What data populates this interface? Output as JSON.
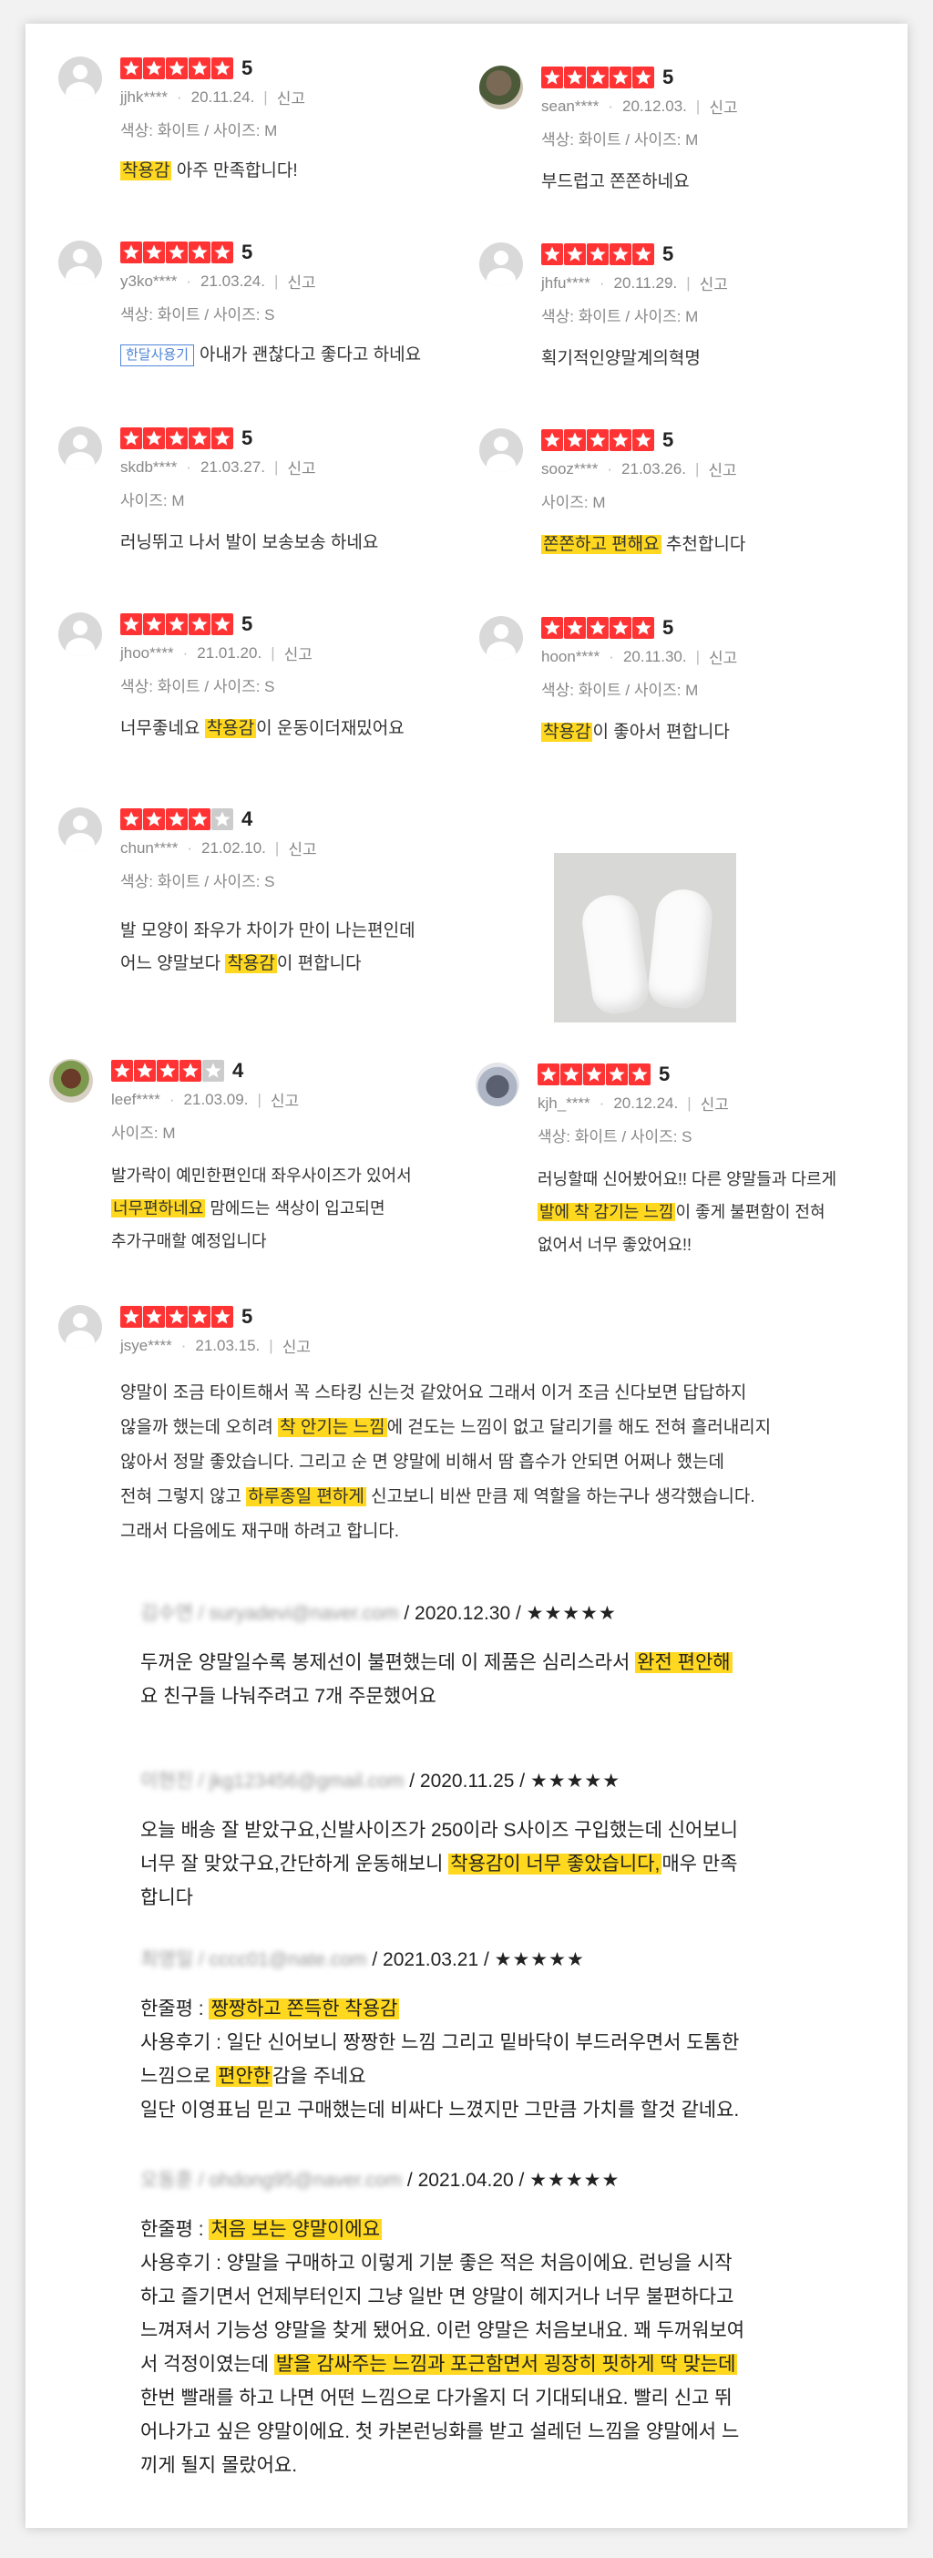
{
  "reviews": [
    {
      "user": "jjhk****",
      "date": "20.11.24.",
      "report": "신고",
      "option": "색상: 화이트 / 사이즈: M",
      "score": "5",
      "rating": 5,
      "text_pre": "",
      "highlight": "착용감",
      "text_post": " 아주 만족합니다!"
    },
    {
      "user": "sean****",
      "date": "20.12.03.",
      "report": "신고",
      "option": "색상: 화이트 / 사이즈: M",
      "score": "5",
      "rating": 5,
      "text_pre": "부드럽고 쫀쫀하네요",
      "highlight": "",
      "text_post": ""
    },
    {
      "user": "y3ko****",
      "date": "21.03.24.",
      "report": "신고",
      "option": "색상: 화이트 / 사이즈: S",
      "score": "5",
      "rating": 5,
      "tag": "한달사용기",
      "text_pre": "아내가 괜찮다고 좋다고 하네요",
      "highlight": "",
      "text_post": ""
    },
    {
      "user": "jhfu****",
      "date": "20.11.29.",
      "report": "신고",
      "option": "색상: 화이트 / 사이즈: M",
      "score": "5",
      "rating": 5,
      "text_pre": "획기적인양말계의혁명",
      "highlight": "",
      "text_post": ""
    },
    {
      "user": "skdb****",
      "date": "21.03.27.",
      "report": "신고",
      "option": "사이즈: M",
      "score": "5",
      "rating": 5,
      "text_pre": "러닝뛰고 나서 발이 보송보송 하네요",
      "highlight": "",
      "text_post": ""
    },
    {
      "user": "sooz****",
      "date": "21.03.26.",
      "report": "신고",
      "option": "사이즈: M",
      "score": "5",
      "rating": 5,
      "text_pre": "",
      "highlight": "쫀쫀하고 편해요",
      "text_post": " 추천합니다"
    },
    {
      "user": "jhoo****",
      "date": "21.01.20.",
      "report": "신고",
      "option": "색상: 화이트 / 사이즈: S",
      "score": "5",
      "rating": 5,
      "text_pre": "너무좋네요 ",
      "highlight": "착용감",
      "text_post": "이 운동이더재밌어요"
    },
    {
      "user": "hoon****",
      "date": "20.11.30.",
      "report": "신고",
      "option": "색상: 화이트 / 사이즈: M",
      "score": "5",
      "rating": 5,
      "text_pre": "",
      "highlight": "착용감",
      "text_post": "이 좋아서 편합니다"
    },
    {
      "user": "chun****",
      "date": "21.02.10.",
      "report": "신고",
      "option": "색상: 화이트 / 사이즈: S",
      "score": "4",
      "rating": 4,
      "line1": "발 모양이 좌우가 차이가 만이 나는편인데",
      "line2_pre": "어느 양말보다 ",
      "highlight": "착용감",
      "line2_post": "이 편합니다"
    },
    {
      "user": "leef****",
      "date": "21.03.09.",
      "report": "신고",
      "option": "사이즈: M",
      "score": "4",
      "rating": 4,
      "line1": "발가락이 예민한편인대 좌우사이즈가 있어서",
      "line2_pre": "",
      "highlight": "너무편하네요",
      "line2_post": " 맘에드는 색상이 입고되면",
      "line3": "추가구매할 예정입니다"
    },
    {
      "user": "kjh_****",
      "date": "20.12.24.",
      "report": "신고",
      "option": "색상: 화이트 / 사이즈: S",
      "score": "5",
      "rating": 5,
      "line1": "러닝할때 신어봤어요!! 다른 양말들과 다르게",
      "line2_pre": "",
      "highlight": "발에 착 감기는 느낌",
      "line2_post": "이 좋게 불편함이 전혀",
      "line3": "없어서 너무 좋았어요!!"
    },
    {
      "user": "jsye****",
      "date": "21.03.15.",
      "report": "신고",
      "score": "5",
      "rating": 5,
      "l1": "양말이 조금 타이트해서 꼭 스타킹 신는것 같았어요 그래서 이거 조금 신다보면 답답하지",
      "l2_pre": "않을까 했는데 오히려 ",
      "l2_hl": "착 안기는 느낌",
      "l2_post": "에 걷도는 느낌이 없고 달리기를 해도 전혀 흘러내리지",
      "l3": "않아서 정말 좋았습니다. 그리고 순 면 양말에 비해서 땀 흡수가 안되면 어쩌나 했는데",
      "l4_pre": "전혀 그렇지 않고 ",
      "l4_hl": "하루종일 편하게",
      "l4_post": " 신고보니 비싼 만큼 제 역할을 하는구나 생각했습니다.",
      "l5": "그래서 다음에도 재구매 하려고 합니다."
    }
  ],
  "emails": [
    {
      "name": "김수연 / suryadevi@naver.com",
      "meta": " / 2020.12.30 / ",
      "stars": "★★★★★",
      "l1_pre": "두꺼운 양말일수록 봉제선이 불편했는데 이 제품은 심리스라서 ",
      "l1_hl": "완전 편안해",
      "l2": "요 친구들 나눠주려고 7개 주문했어요"
    },
    {
      "name": "이현진 / jkg123456@gmail.com",
      "meta": " / 2020.11.25 / ",
      "stars": "★★★★★",
      "l1": "오늘 배송 잘 받았구요,신발사이즈가 250이라 S사이즈 구입했는데 신어보니",
      "l2_pre": "너무 잘 맞았구요,간단하게 운동해보니 ",
      "l2_hl": "착용감이 너무 좋았습니다,",
      "l2_post": "매우 만족",
      "l3": "합니다"
    },
    {
      "name": "최영일 / cccc01@nate.com",
      "meta": " / 2021.03.21 / ",
      "stars": "★★★★★",
      "l1_pre": "한줄평 : ",
      "l1_hl": "짱짱하고 쫀득한 착용감",
      "l2": "사용후기 : 일단 신어보니 짱짱한 느낌 그리고 밑바닥이 부드러우면서 도톰한",
      "l3_pre": "느낌으로 ",
      "l3_hl": "편안한",
      "l3_post": "감을 주네요",
      "l4": "일단 이영표님 믿고 구매했는데 비싸다 느꼈지만 그만큼 가치를 할것 같네요."
    },
    {
      "name": "오동훈 / ohdong95@naver.com",
      "meta": " / 2021.04.20 / ",
      "stars": "★★★★★",
      "l1_pre": "한줄평 : ",
      "l1_hl": "처음 보는 양말이에요",
      "l2": "사용후기 : 양말을 구매하고 이렇게 기분 좋은 적은 처음이에요. 런닝을 시작",
      "l3": "하고 즐기면서 언제부터인지 그냥 일반 면 양말이 헤지거나 너무 불편하다고",
      "l4": "느껴져서 기능성 양말을 찾게 됐어요. 이런 양말은 처음보내요. 꽤 두꺼워보여",
      "l5_pre": "서 걱정이였는데 ",
      "l5_hl": "발을 감싸주는 느낌과 포근함면서 굉장히 핏하게 딱 맞는데",
      "l6": "한번 빨래를 하고 나면 어떤 느낌으로 다가올지 더 기대되내요. 빨리 신고 뛰",
      "l7": "어나가고 싶은 양말이에요. 첫 카본런닝화를 받고 설레던 느낌을 양말에서 느",
      "l8": "끼게 될지 몰랐어요."
    }
  ],
  "colors": {
    "star": "#ff3333",
    "star_empty": "#cccccc",
    "highlight": "#ffd81f",
    "tag": "#4f86d8"
  }
}
